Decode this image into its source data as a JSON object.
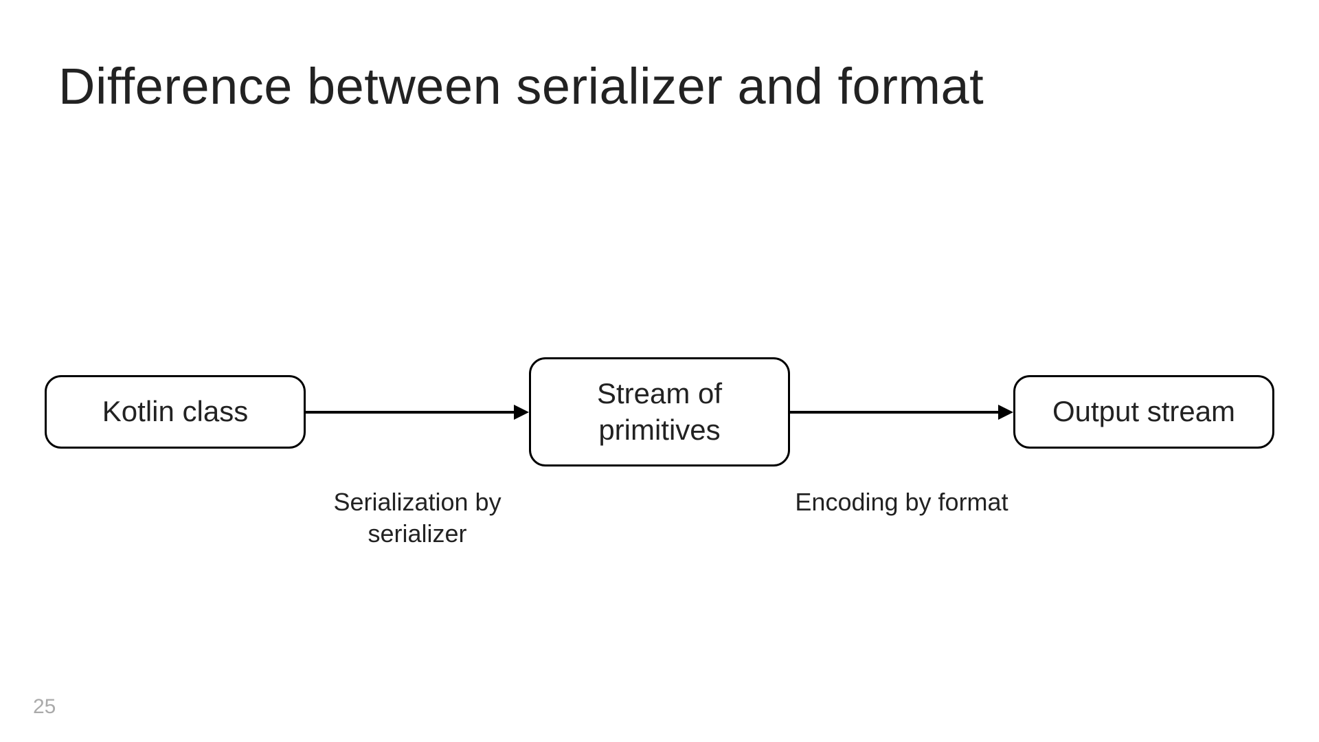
{
  "title": "Difference between serializer and format",
  "diagram": {
    "boxes": [
      {
        "label": "Kotlin class"
      },
      {
        "label": "Stream of primitives"
      },
      {
        "label": "Output stream"
      }
    ],
    "arrows": [
      {
        "label": "Serialization by serializer"
      },
      {
        "label": "Encoding by format"
      }
    ]
  },
  "page_number": "25"
}
